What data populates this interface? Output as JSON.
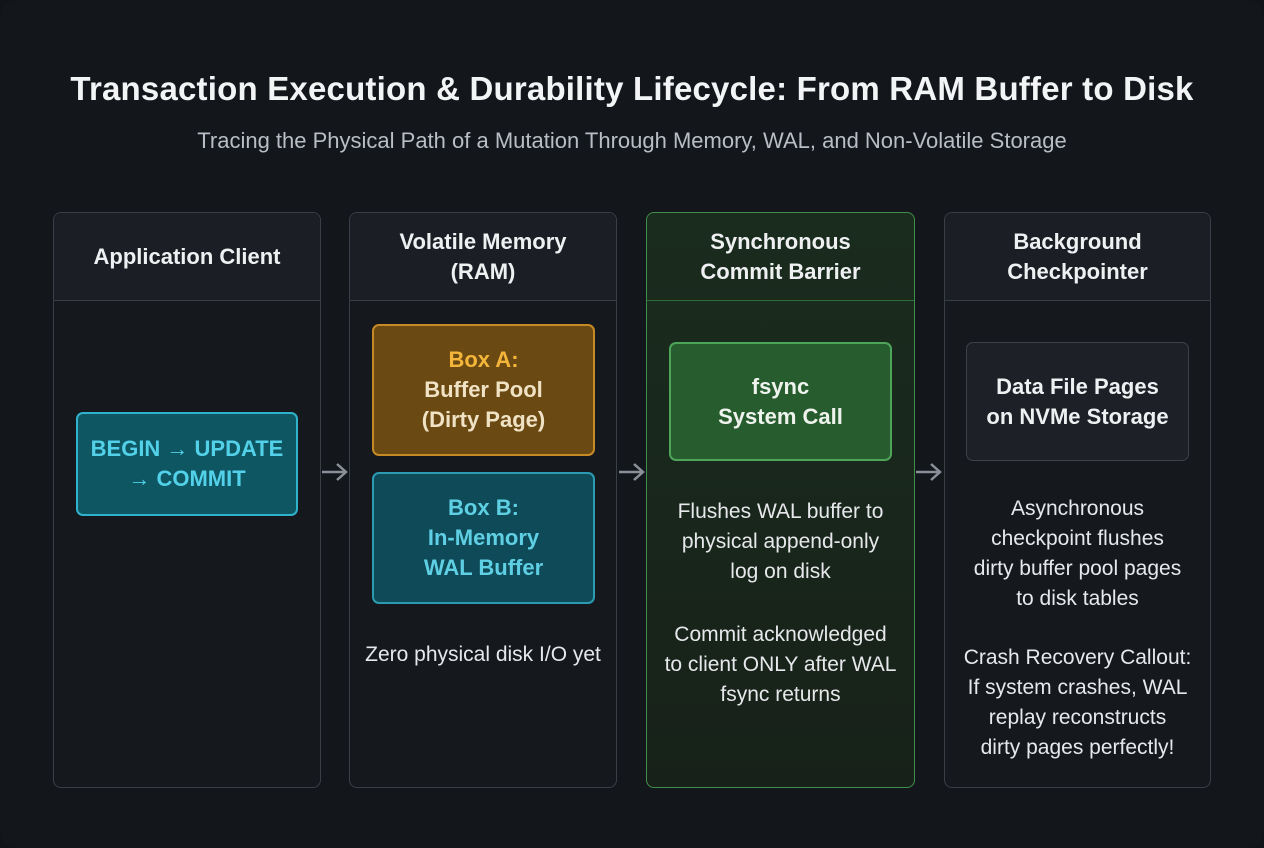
{
  "title": "Transaction Execution & Durability Lifecycle: From RAM Buffer to Disk",
  "subtitle": "Tracing the Physical Path of a Mutation Through Memory, WAL, and Non-Volatile Storage",
  "columns": {
    "client": {
      "header": "Application Client",
      "box_line1": "BEGIN → UPDATE",
      "box_line2": "→ COMMIT"
    },
    "memory": {
      "header_line1": "Volatile Memory",
      "header_line2": "(RAM)",
      "box_a_line1": "Box A:",
      "box_a_line2": "Buffer Pool",
      "box_a_line3": "(Dirty Page)",
      "box_b_line1": "Box B:",
      "box_b_line2": "In-Memory",
      "box_b_line3": "WAL Buffer",
      "note": "Zero physical disk I/O yet"
    },
    "commit": {
      "header_line1": "Synchronous",
      "header_line2": "Commit Barrier",
      "box_line1": "fsync",
      "box_line2": "System Call",
      "note1": [
        "Flushes WAL buffer to",
        "physical append-only",
        "log on disk"
      ],
      "note2": [
        "Commit acknowledged",
        "to client ONLY after WAL",
        "fsync returns"
      ]
    },
    "checkpointer": {
      "header_line1": "Background",
      "header_line2": "Checkpointer",
      "box_line1": "Data File Pages",
      "box_line2": "on NVMe Storage",
      "note1": [
        "Asynchronous",
        "checkpoint flushes",
        "dirty buffer pool pages",
        "to disk tables"
      ],
      "note2": [
        "Crash Recovery Callout:",
        "If system crashes, WAL",
        "replay reconstructs",
        "dirty pages perfectly!"
      ]
    }
  },
  "icons": [
    "arrow-right-icon"
  ],
  "colors": {
    "background": "#13161b",
    "cyan_accent": "#2fb3cc",
    "orange_accent": "#c58a24",
    "green_accent": "#3f8f4a"
  }
}
